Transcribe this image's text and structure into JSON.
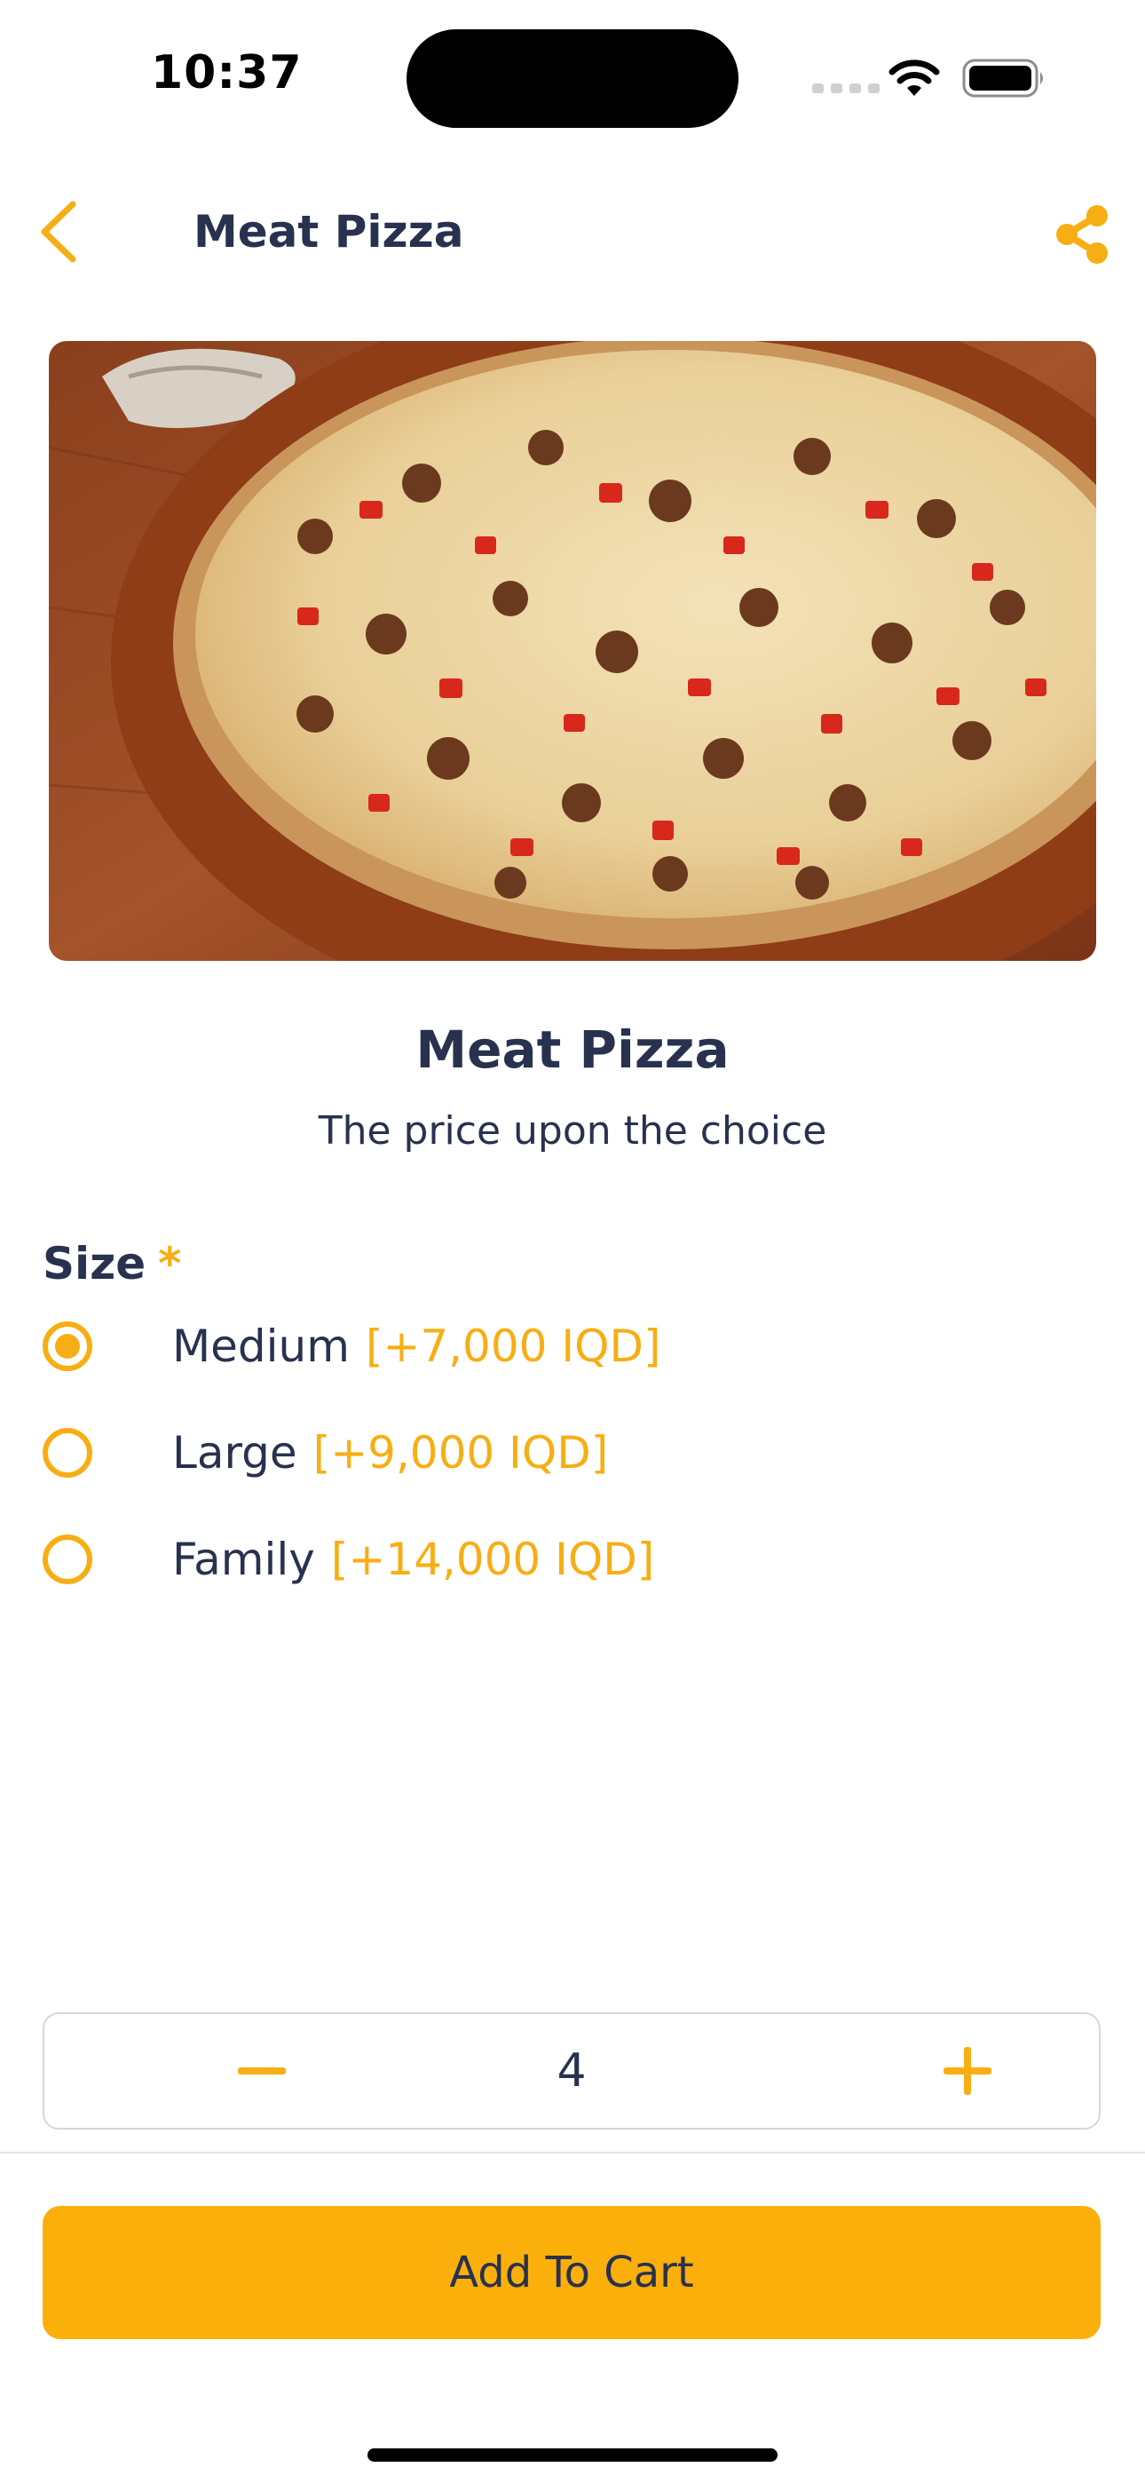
{
  "status_bar": {
    "time": "10:37",
    "icons": [
      "cellular-signal-icon",
      "wifi-icon",
      "battery-icon"
    ]
  },
  "nav": {
    "title": "Meat Pizza",
    "back_icon": "chevron-left-icon",
    "share_icon": "share-icon"
  },
  "product": {
    "image": "pizza-photo",
    "title": "Meat Pizza",
    "subtitle": "The price upon the choice"
  },
  "size": {
    "label": "Size",
    "required_mark": "*",
    "options": [
      {
        "name": "Medium",
        "price": "[+7,000 IQD]",
        "selected": true
      },
      {
        "name": "Large",
        "price": "[+9,000 IQD]",
        "selected": false
      },
      {
        "name": "Family",
        "price": "[+14,000 IQD]",
        "selected": false
      }
    ]
  },
  "quantity": {
    "value": "4",
    "minus_icon": "minus-icon",
    "plus_icon": "plus-icon"
  },
  "cart_button": {
    "label": "Add To Cart"
  },
  "colors": {
    "accent": "#f7ae14",
    "text": "#28324f",
    "button": "#fbaf0a"
  }
}
